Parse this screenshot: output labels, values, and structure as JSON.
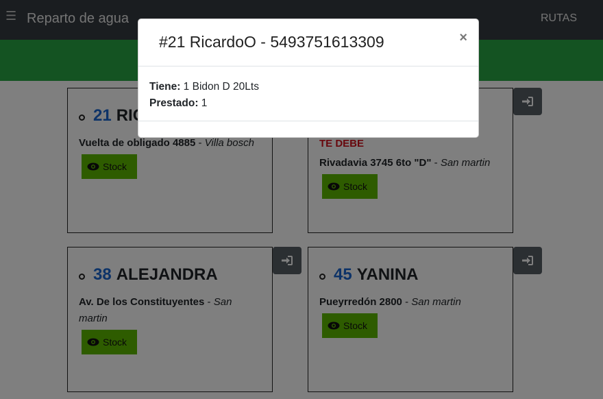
{
  "navbar": {
    "menu_icon": "☰",
    "brand": "Reparto de agua",
    "rutas_link": "RUTAS"
  },
  "cards": [
    {
      "number": "21",
      "name": "RICARDOO",
      "debt": "",
      "street": "Vuelta de obligado 4885",
      "separator": " - ",
      "city": "Villa bosch",
      "stock_label": "Stock"
    },
    {
      "number": "",
      "name": "",
      "debt": "TE DEBE",
      "street": "Rivadavia 3745 6to \"D\"",
      "separator": " - ",
      "city": "San martin",
      "stock_label": "Stock"
    },
    {
      "number": "38",
      "name": "ALEJANDRA",
      "debt": "",
      "street": "Av. De los Constituyentes",
      "separator": " - ",
      "city": "San martin",
      "stock_label": "Stock"
    },
    {
      "number": "45",
      "name": "YANINA",
      "debt": "",
      "street": "Pueyrredón 2800",
      "separator": " - ",
      "city": "San martin",
      "stock_label": "Stock"
    }
  ],
  "modal": {
    "title": "#21 RicardoO - 5493751613309",
    "close": "×",
    "tiene_label": "Tiene:",
    "tiene_value": " 1 Bidon D 20Lts",
    "prestado_label": "Prestado:",
    "prestado_value": " 1"
  },
  "colors": {
    "navbar": "#343a40",
    "greenbar": "#28a745",
    "stock_button": "#5cb800",
    "number_blue": "#1a66d0",
    "debt_red": "#d0111b",
    "login_button": "#565e64"
  },
  "icons": {
    "menu": "hamburger-menu-icon",
    "eye": "eye-icon",
    "login": "sign-in-icon",
    "close": "close-icon"
  }
}
